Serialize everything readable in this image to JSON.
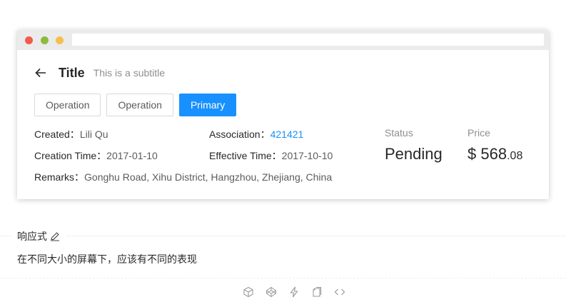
{
  "page_header": {
    "title": "Title",
    "subtitle": "This is a subtitle",
    "back_icon": "arrow-left-icon",
    "buttons": [
      "Operation",
      "Operation",
      "Primary"
    ]
  },
  "descriptions": {
    "created_label": "Created：",
    "created_value": "Lili Qu",
    "association_label": "Association：",
    "association_value": "421421",
    "creation_time_label": "Creation Time：",
    "creation_time_value": "2017-01-10",
    "effective_time_label": "Effective Time：",
    "effective_time_value": "2017-10-10",
    "remarks_label": "Remarks：",
    "remarks_value": "Gonghu Road, Xihu District, Hangzhou, Zhejiang, China"
  },
  "statistics": {
    "status_title": "Status",
    "status_value": "Pending",
    "price_title": "Price",
    "price_prefix": "$",
    "price_int": "568",
    "price_decimal": ".08"
  },
  "demo": {
    "title": "响应式",
    "description": "在不同大小的屏幕下，应该有不同的表现",
    "action_icons": [
      "codesandbox-icon",
      "codepen-icon",
      "thunderbolt-icon",
      "copy-icon",
      "code-icon"
    ]
  },
  "colors": {
    "primary": "#1890ff",
    "dot_red": "#f25a4c",
    "dot_green": "#8dbb3c",
    "dot_yellow": "#f7be4d"
  }
}
